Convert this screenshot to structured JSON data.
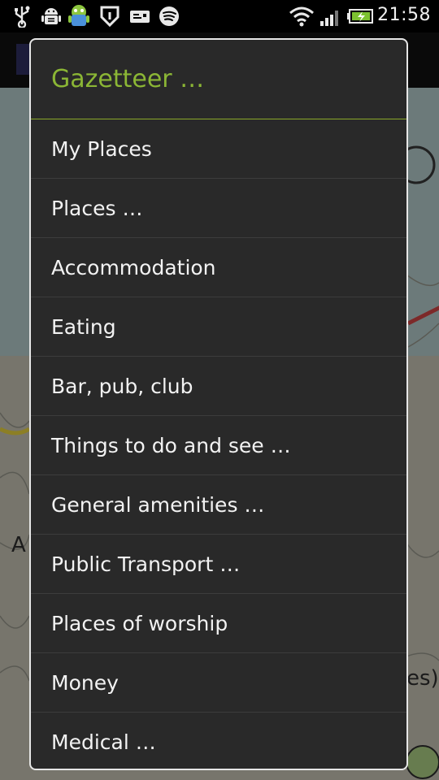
{
  "status_bar": {
    "time": "21:58",
    "icons": [
      "usb-icon",
      "android-debug-icon",
      "android-mascot-icon",
      "app-shield-icon",
      "message-icon",
      "spotify-icon",
      "wifi-icon",
      "signal-icon",
      "battery-charging-icon"
    ]
  },
  "background_map": {
    "partial_labels": {
      "left": "A",
      "right": "es)"
    },
    "colors": {
      "water": "#a7bcbc",
      "land": "#b7b4a7"
    }
  },
  "dialog": {
    "title": "Gazetteer …",
    "title_color": "#8bb635",
    "items": [
      {
        "label": "My Places"
      },
      {
        "label": "Places …"
      },
      {
        "label": "Accommodation"
      },
      {
        "label": "Eating"
      },
      {
        "label": "Bar, pub, club"
      },
      {
        "label": "Things to do and see …"
      },
      {
        "label": "General amenities …"
      },
      {
        "label": "Public Transport …"
      },
      {
        "label": "Places of worship"
      },
      {
        "label": "Money"
      },
      {
        "label": "Medical …"
      }
    ]
  }
}
